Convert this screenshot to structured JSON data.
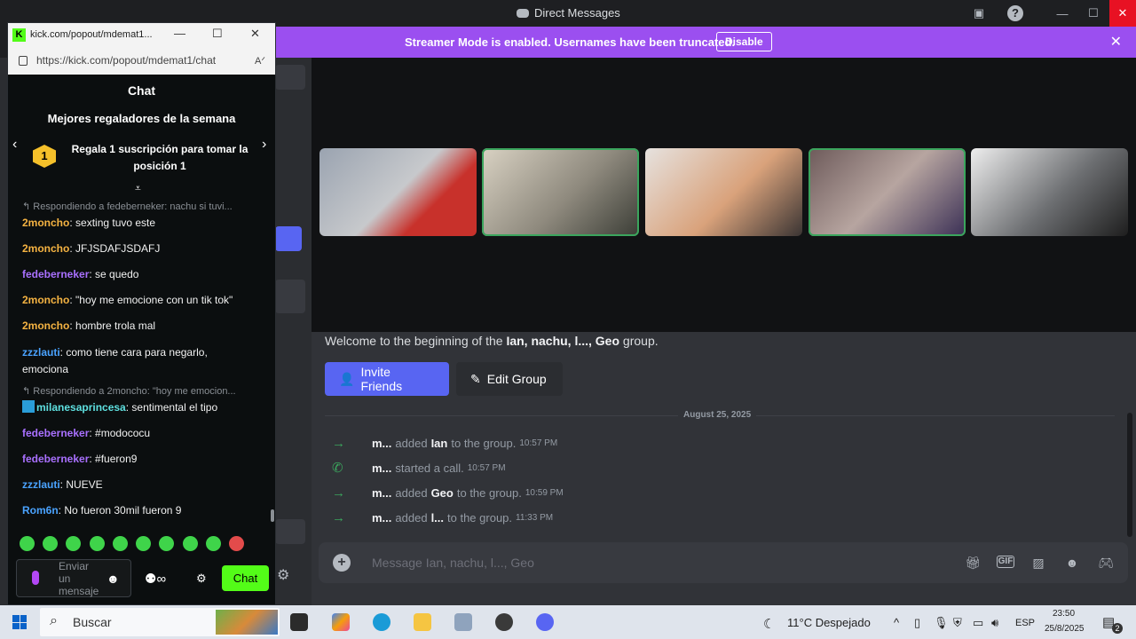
{
  "window": {
    "title": "Direct Messages"
  },
  "streamer_banner": {
    "message": "Streamer Mode is enabled. Usernames have been truncated.",
    "disable_label": "Disable"
  },
  "group": {
    "welcome_prefix": "Welcome to the beginning of the",
    "welcome_name": "Ian, nachu, l..., Geo",
    "welcome_suffix": "group.",
    "invite_label": "Invite Friends",
    "edit_label": "Edit Group"
  },
  "date_divider": "August 25, 2025",
  "system_messages": [
    {
      "icon": "arrow-right-icon",
      "who": "m...",
      "action": "added",
      "target": "Ian",
      "tail": "to the group.",
      "time": "10:57 PM"
    },
    {
      "icon": "phone-icon",
      "who": "m...",
      "action": "started a call.",
      "target": "",
      "tail": "",
      "time": "10:57 PM"
    },
    {
      "icon": "arrow-right-icon",
      "who": "m...",
      "action": "added",
      "target": "Geo",
      "tail": "to the group.",
      "time": "10:59 PM"
    },
    {
      "icon": "arrow-right-icon",
      "who": "m...",
      "action": "added",
      "target": "l...",
      "tail": "to the group.",
      "time": "11:33 PM"
    }
  ],
  "composer": {
    "placeholder": "Message Ian, nachu, l..., Geo"
  },
  "kick": {
    "tab_title": "kick.com/popout/mdemat1...",
    "url": "https://kick.com/popout/mdemat1/chat",
    "chat_title": "Chat",
    "gifters_title": "Mejores regaladores de la semana",
    "gift_rank": "1",
    "gift_text": "Regala 1 suscripción para tomar la posición 1",
    "messages": [
      {
        "reply": "Respondiendo a fedeberneker: nachu si tuvi..."
      },
      {
        "user": "2moncho",
        "color": "#f5b342",
        "text": "sexting tuvo este"
      },
      {
        "user": "2moncho",
        "color": "#f5b342",
        "text": "JFJSDAFJSDAFJ"
      },
      {
        "user": "fedeberneker",
        "color": "#a970ff",
        "text": "se quedo"
      },
      {
        "user": "2moncho",
        "color": "#f5b342",
        "text": "\"hoy me emocione con un tik tok\""
      },
      {
        "user": "2moncho",
        "color": "#f5b342",
        "text": "hombre trola mal"
      },
      {
        "user": "zzzlauti",
        "color": "#4aa3ff",
        "text": "como tiene cara para negarlo, emociona"
      },
      {
        "reply": "Respondiendo a 2moncho: \"hoy me emocion..."
      },
      {
        "user": "milanesaprincesa",
        "color": "#5ee0e0",
        "text": "sentimental el tipo"
      },
      {
        "user": "fedeberneker",
        "color": "#a970ff",
        "text": "#modococu"
      },
      {
        "user": "fedeberneker",
        "color": "#a970ff",
        "text": "#fueron9"
      },
      {
        "user": "zzzlauti",
        "color": "#4aa3ff",
        "text": "NUEVE"
      },
      {
        "user": "Rom6n",
        "color": "#4aa3ff",
        "text": "No fueron 30mil fueron 9"
      }
    ],
    "input_placeholder": "Enviar un mensaje",
    "chat_button": "Chat"
  },
  "taskbar": {
    "search_placeholder": "Buscar",
    "weather": "11°C  Despejado",
    "lang": "ESP",
    "time": "23:50",
    "date": "25/8/2025",
    "notifications": "2"
  },
  "colors": {
    "blurple": "#5865f2",
    "kick_green": "#53fc18",
    "streamer_purple": "#9b4ff0",
    "call_green": "#3ba55d"
  }
}
